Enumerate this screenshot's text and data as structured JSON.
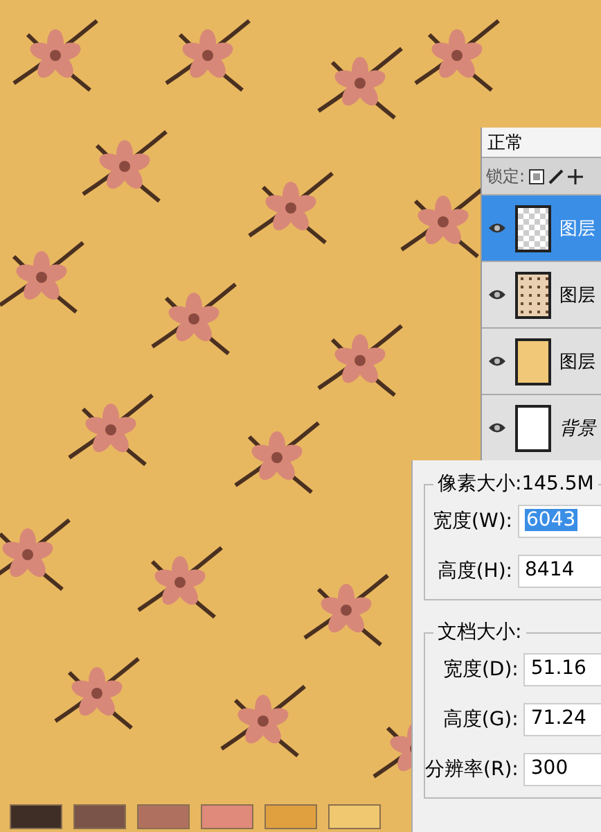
{
  "layers_panel": {
    "blend_mode": "正常",
    "lock_label": "锁定:",
    "layers": [
      {
        "name": "图层",
        "kind": "transparent",
        "selected": true
      },
      {
        "name": "图层",
        "kind": "pattern",
        "selected": false
      },
      {
        "name": "图层",
        "kind": "solid",
        "selected": false
      },
      {
        "name": "背景",
        "kind": "background",
        "selected": false
      }
    ]
  },
  "image_size_dialog": {
    "groups": [
      {
        "title": "像素大小:145.5M",
        "fields": [
          {
            "label": "宽度(W):",
            "value": "6043",
            "selected": true
          },
          {
            "label": "高度(H):",
            "value": "8414",
            "selected": false
          }
        ]
      },
      {
        "title": "文档大小:",
        "fields": [
          {
            "label": "宽度(D):",
            "value": "51.16",
            "selected": false
          },
          {
            "label": "高度(G):",
            "value": "71.24",
            "selected": false
          },
          {
            "label": "分辨率(R):",
            "value": "300",
            "selected": false
          }
        ]
      }
    ]
  },
  "swatches": [
    {
      "color": "#3e2e26"
    },
    {
      "color": "#7a5448"
    },
    {
      "color": "#b0705f"
    },
    {
      "color": "#e08a7c"
    },
    {
      "color": "#e0a040"
    },
    {
      "color": "#f0c870"
    }
  ]
}
